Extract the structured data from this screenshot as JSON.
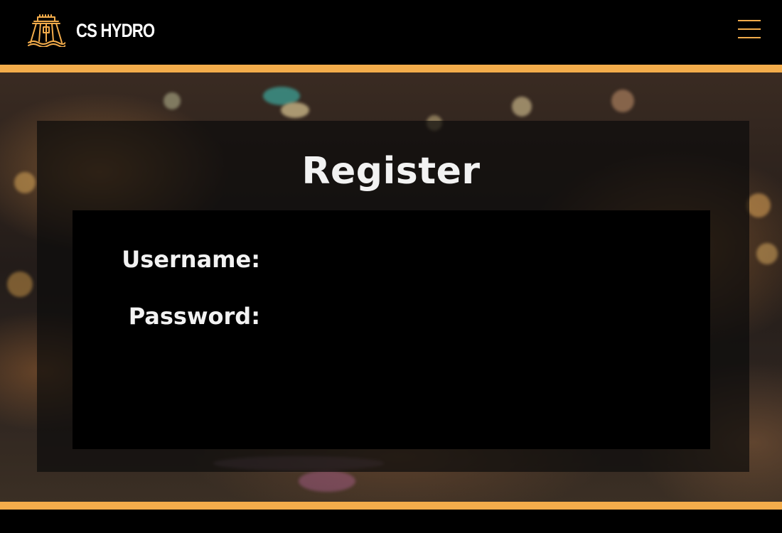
{
  "header": {
    "brand_name": "CS HYDRO",
    "logo_icon": "dam-tower-logo",
    "menu_icon": "hamburger-menu-icon"
  },
  "colors": {
    "accent": "#f3ac4b",
    "background": "#000000",
    "text": "#f2f2f2"
  },
  "register_form": {
    "title": "Register",
    "username_label": "Username:",
    "username_value": "",
    "password_label": "Password:",
    "password_value": ""
  }
}
